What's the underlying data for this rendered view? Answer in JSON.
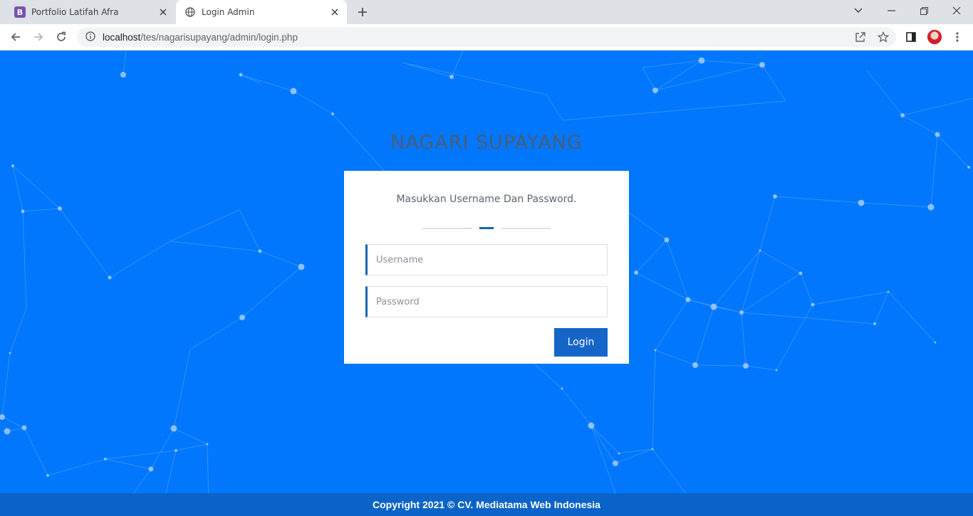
{
  "browser": {
    "tabs": [
      {
        "title": "Portfolio Latifah Afra",
        "favicon": "bootstrap-icon",
        "active": false
      },
      {
        "title": "Login Admin",
        "favicon": "globe-icon",
        "active": true
      }
    ],
    "url_host": "localhost",
    "url_path": "/tes/nagarisupayang/admin/login.php"
  },
  "page": {
    "brand": "NAGARI SUPAYANG",
    "subtitle": "Masukkan Username Dan Password.",
    "username_placeholder": "Username",
    "password_placeholder": "Password",
    "login_label": "Login",
    "footer": "Copyright 2021 © CV. Mediatama Web Indonesia"
  },
  "colors": {
    "background": "#0077fd",
    "accent": "#1565c9",
    "brand_text": "#4a5c76",
    "footer_bg": "#0a63c8"
  }
}
